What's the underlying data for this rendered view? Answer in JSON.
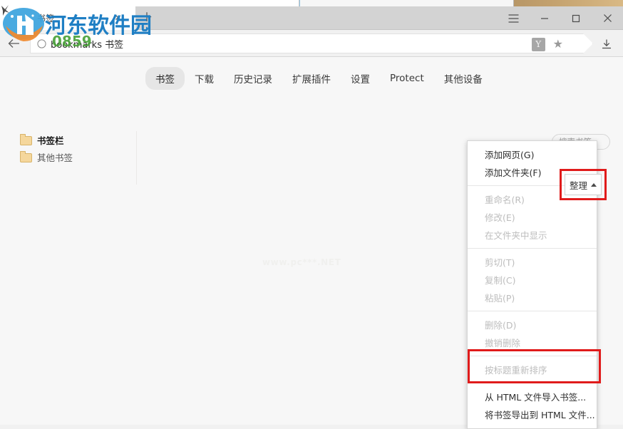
{
  "window": {
    "tab": {
      "title": "书签",
      "close_icon": "close-icon",
      "new_tab_icon": "plus-icon"
    },
    "controls": {
      "menu_icon": "hamburger-menu-icon",
      "minimize_icon": "minimize-icon",
      "maximize_icon": "maximize-icon",
      "close_icon": "close-icon"
    }
  },
  "toolbar": {
    "back_icon": "back-arrow-icon",
    "omnibox_icon": "page-info-icon",
    "url_text": "bookmarks 书签",
    "translate_badge": "Y",
    "star_icon": "star-icon",
    "download_icon": "download-icon"
  },
  "nav": {
    "tabs": [
      {
        "label": "书签",
        "active": true
      },
      {
        "label": "下载",
        "active": false
      },
      {
        "label": "历史记录",
        "active": false
      },
      {
        "label": "扩展插件",
        "active": false
      },
      {
        "label": "设置",
        "active": false
      },
      {
        "label": "Protect",
        "active": false
      },
      {
        "label": "其他设备",
        "active": false
      }
    ]
  },
  "search": {
    "placeholder": "搜索书签"
  },
  "sidebar": {
    "items": [
      {
        "label": "书签栏",
        "icon": "folder-icon",
        "selected": true
      },
      {
        "label": "其他书签",
        "icon": "folder-icon",
        "selected": false
      }
    ]
  },
  "organize": {
    "label": "整理",
    "caret_icon": "chevron-up-icon",
    "highlight_color": "#e01b1b"
  },
  "menu": {
    "groups": [
      {
        "items": [
          {
            "label": "添加网页(G)",
            "disabled": false
          },
          {
            "label": "添加文件夹(F)",
            "disabled": false
          }
        ]
      },
      {
        "items": [
          {
            "label": "重命名(R)",
            "disabled": true
          },
          {
            "label": "修改(E)",
            "disabled": true
          },
          {
            "label": "在文件夹中显示",
            "disabled": true
          }
        ]
      },
      {
        "items": [
          {
            "label": "剪切(T)",
            "disabled": true
          },
          {
            "label": "复制(C)",
            "disabled": true
          },
          {
            "label": "粘贴(P)",
            "disabled": true
          }
        ]
      },
      {
        "items": [
          {
            "label": "删除(D)",
            "disabled": true
          },
          {
            "label": "撤销删除",
            "disabled": true
          }
        ]
      },
      {
        "items": [
          {
            "label": "按标题重新排序",
            "disabled": true
          }
        ]
      },
      {
        "items": [
          {
            "label": "从 HTML 文件导入书签...",
            "disabled": false
          },
          {
            "label": "将书签导出到 HTML 文件...",
            "disabled": false
          }
        ]
      }
    ]
  },
  "watermarks": {
    "center": "www.pc***.NET",
    "brand_cn": "河东软件园",
    "brand_green": "0859"
  }
}
